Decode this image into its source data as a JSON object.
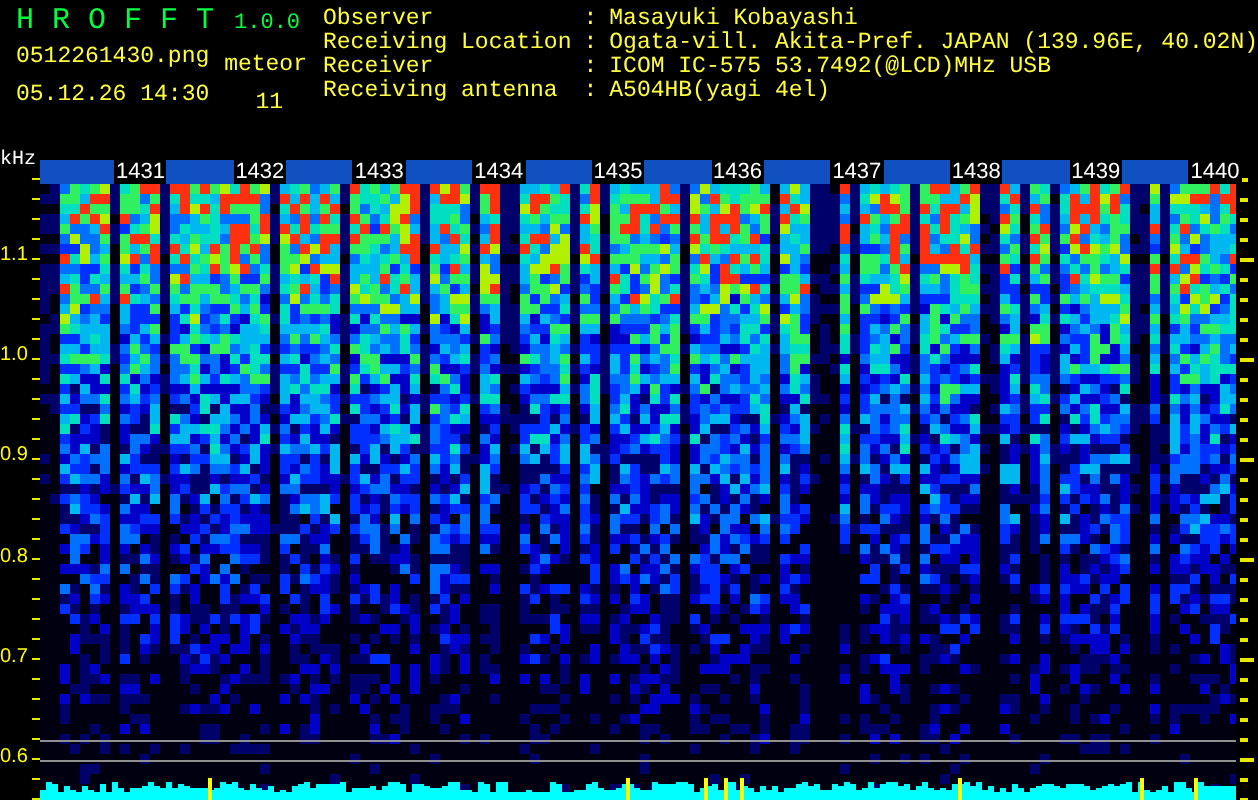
{
  "app": {
    "title": "H R O F F T",
    "version": "1.0.0"
  },
  "file": "0512261430.png",
  "datetime": "05.12.26 14:30",
  "meteor": {
    "label": "meteor",
    "count": "11"
  },
  "info": [
    {
      "label": "Observer",
      "separator": ":",
      "value": "Masayuki Kobayashi"
    },
    {
      "label": "Receiving Location",
      "separator": ":",
      "value": "Ogata-vill. Akita-Pref. JAPAN (139.96E, 40.02N)"
    },
    {
      "label": "Receiver",
      "separator": ":",
      "value": "ICOM IC-575 53.7492(@LCD)MHz USB"
    },
    {
      "label": "Receiving antenna",
      "separator": ":",
      "value": "A504HB(yagi 4el)"
    }
  ],
  "spectrogram": {
    "y_unit": "kHz",
    "y_labels": [
      "1.1",
      "1.0",
      "0.9",
      "0.8",
      "0.7",
      "0.6"
    ],
    "time_labels": [
      "1431",
      "1432",
      "1433",
      "1434",
      "1435",
      "1436",
      "1437",
      "1438",
      "1439",
      "1440"
    ]
  }
}
